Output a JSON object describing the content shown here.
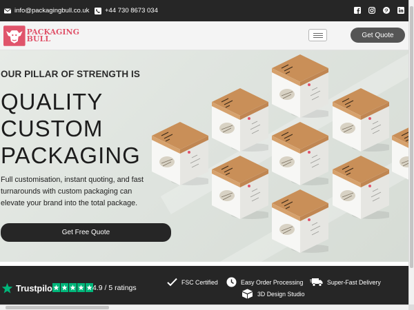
{
  "topbar": {
    "email": "info@packagingbull.co.uk",
    "phone": "+44 730 8673 034",
    "email_icon": "envelope-icon",
    "phone_icon": "phone-icon",
    "social_icons": [
      "facebook-icon",
      "instagram-icon",
      "pinterest-icon",
      "linkedin-icon"
    ]
  },
  "header": {
    "logo_line1": "PACKAGING",
    "logo_line2": "BULL",
    "quote_button": "Get Quote",
    "menu_icon": "hamburger-menu-icon"
  },
  "hero": {
    "kicker": "OUR PILLAR OF STRENGTH IS",
    "headline": [
      "QUALITY",
      "CUSTOM",
      "PACKAGING"
    ],
    "subtext": "Full customisation, instant quoting, and fast turnarounds with custom packaging can elevate your brand into the total package.",
    "cta": "Get Free Quote"
  },
  "features": {
    "trustpilot": "Trustpilot",
    "rating": "4.9 / 5 ratings",
    "stars": 5,
    "items": [
      {
        "label": "FSC Certified",
        "icon": "checkmark-icon"
      },
      {
        "label": "Easy Order Processing",
        "icon": "clock-icon"
      },
      {
        "label": "Super-Fast Delivery",
        "icon": "delivery-truck-icon"
      },
      {
        "label": "3D Design Studio",
        "icon": "3d-box-icon"
      }
    ]
  },
  "colors": {
    "brand": "#e0546b",
    "dark": "#262626",
    "button_grey": "#555555",
    "trustpilot_green": "#00b67a",
    "kraft": "#c98f58"
  }
}
